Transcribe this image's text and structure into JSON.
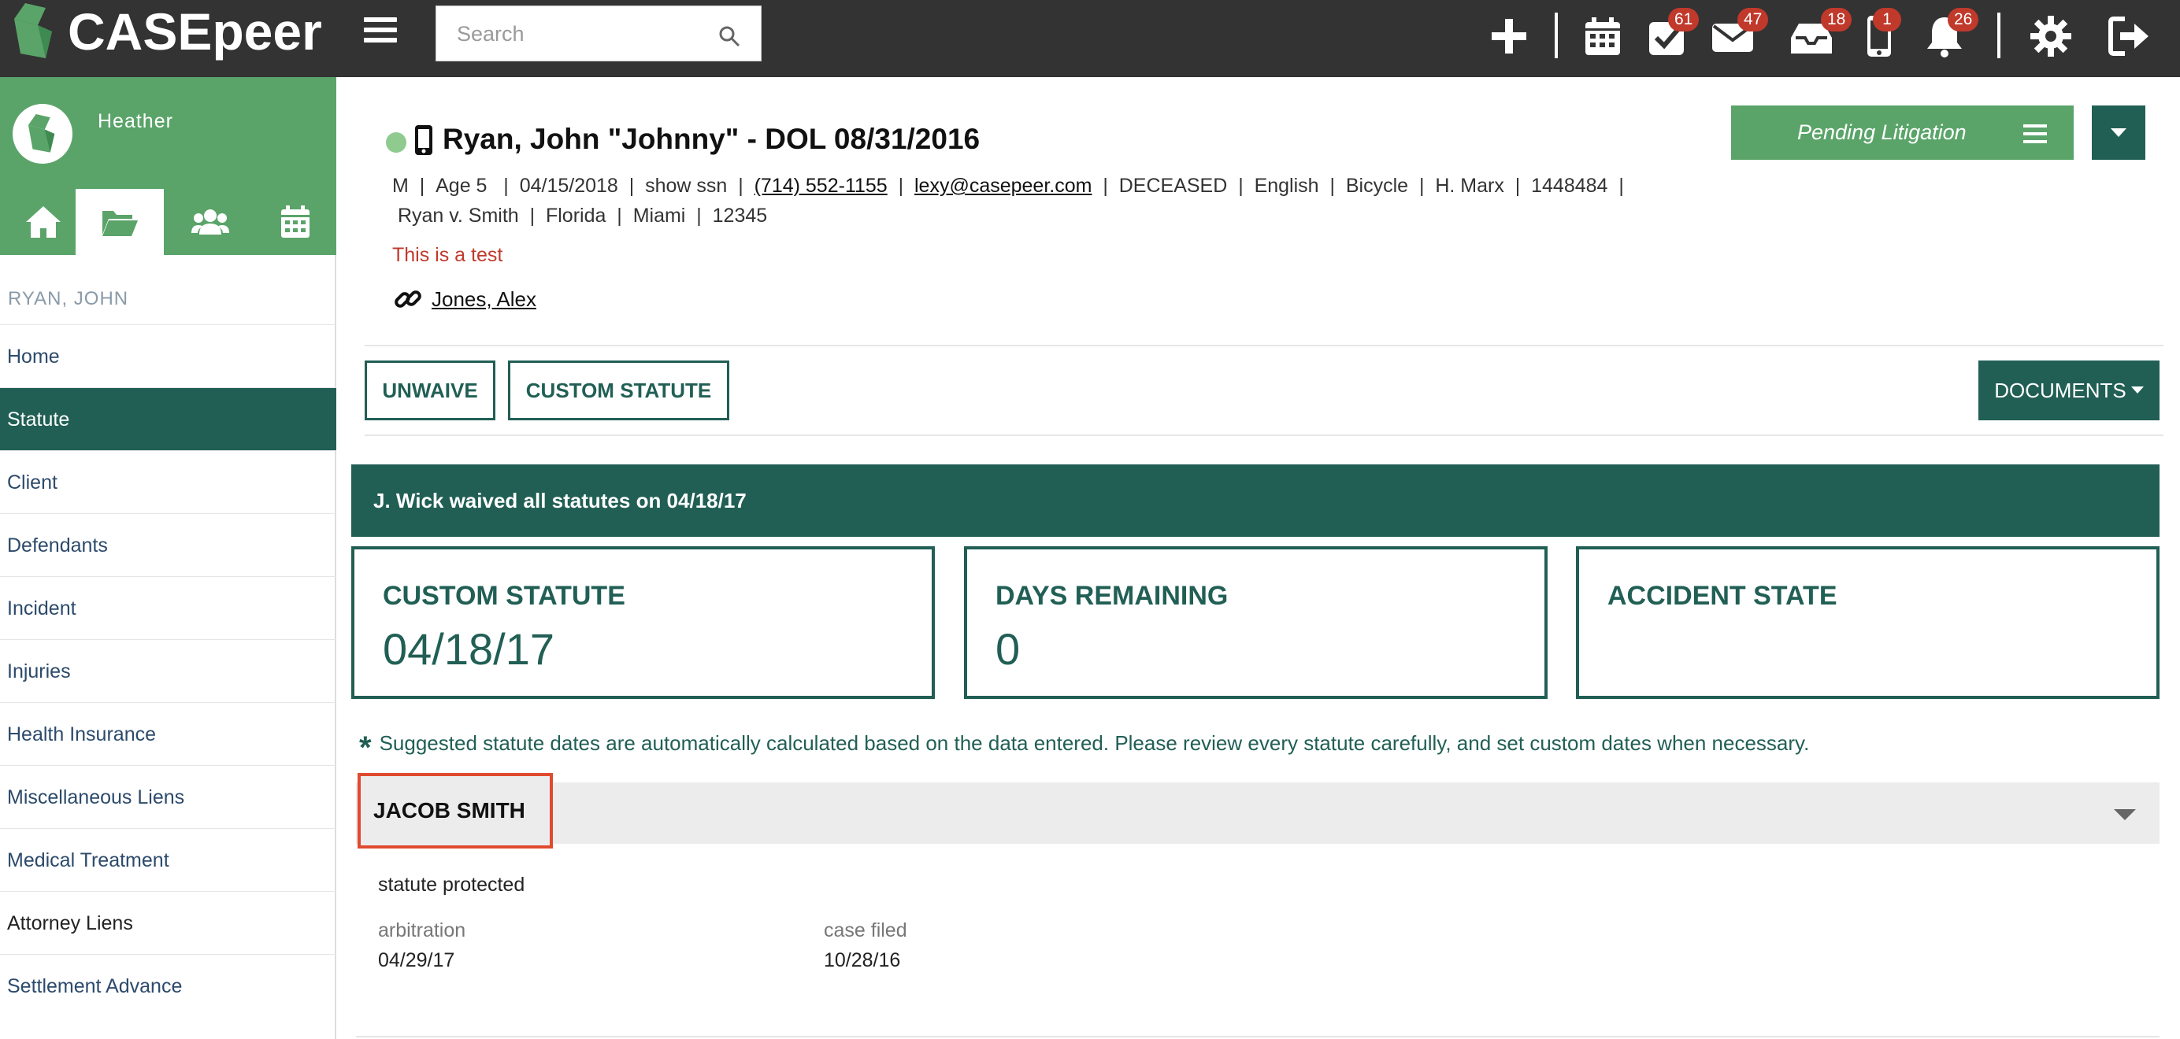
{
  "app": {
    "brand": "CASEpeer",
    "search_placeholder": "Search"
  },
  "topbar": {
    "badges": {
      "tasks": "61",
      "mail": "47",
      "inbox": "18",
      "phone": "1",
      "notifications": "26"
    },
    "colors": {
      "bar": "#333333",
      "badge": "#c0392b"
    }
  },
  "sidebar": {
    "user_name": "Heather",
    "case_name": "RYAN, JOHN",
    "items": [
      {
        "label": "Home"
      },
      {
        "label": "Statute"
      },
      {
        "label": "Client"
      },
      {
        "label": "Defendants"
      },
      {
        "label": "Incident"
      },
      {
        "label": "Injuries"
      },
      {
        "label": "Health Insurance"
      },
      {
        "label": "Miscellaneous Liens"
      },
      {
        "label": "Medical Treatment"
      },
      {
        "label": "Attorney Liens"
      },
      {
        "label": "Settlement Advance"
      }
    ],
    "active_item": "Statute",
    "colors": {
      "green": "#5aa469",
      "dark_green": "#215f55"
    }
  },
  "case": {
    "title": "Ryan, John \"Johnny\" - DOL 08/31/2016",
    "sex": "M",
    "age": "Age 5",
    "dob": "04/15/2018",
    "ssn": "show ssn",
    "phone": "(714) 552-1155",
    "email": "lexy@casepeer.com",
    "status": "DECEASED",
    "language": "English",
    "case_type": "Bicycle",
    "attorney": "H. Marx",
    "case_number": "1448484",
    "case_caption": "Ryan v. Smith",
    "state": "Florida",
    "city": "Miami",
    "zip": "12345",
    "note": "This is a test",
    "related_case": "Jones, Alex",
    "stage": "Pending Litigation"
  },
  "actions": {
    "unwaive": "UNWAIVE",
    "custom_statute": "CUSTOM STATUTE",
    "documents": "DOCUMENTS"
  },
  "statute": {
    "waived_banner": "J. Wick waived all statutes on 04/18/17",
    "cards": [
      {
        "label": "CUSTOM STATUTE",
        "value": "04/18/17"
      },
      {
        "label": "DAYS REMAINING",
        "value": "0"
      },
      {
        "label": "ACCIDENT STATE",
        "value": ""
      }
    ],
    "suggestion_note": "Suggested statute dates are automatically calculated based on the data entered. Please review every statute carefully, and set custom dates when necessary.",
    "defendant": {
      "name": "JACOB SMITH",
      "protected_text": "statute protected",
      "fields": [
        {
          "label": "arbitration",
          "value": "04/29/17"
        },
        {
          "label": "case filed",
          "value": "10/28/16"
        }
      ]
    }
  }
}
